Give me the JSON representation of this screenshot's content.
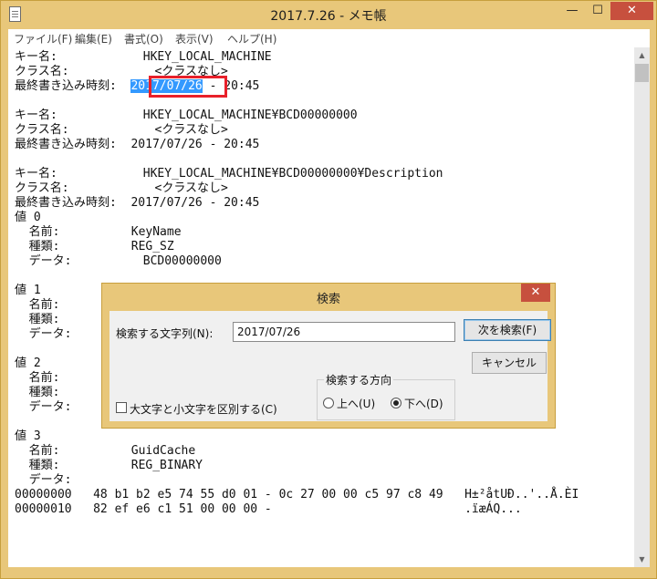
{
  "window": {
    "title": "2017.7.26 - メモ帳",
    "minimize_glyph": "—",
    "maximize_glyph": "☐",
    "close_glyph": "✕"
  },
  "menu": [
    "ファイル(F)",
    "編集(E)",
    "書式(O)",
    "表示(V)",
    "ヘルプ(H)"
  ],
  "editor": {
    "lines": [
      "キー名:            HKEY_LOCAL_MACHINE",
      "クラス名:            <クラスなし>",
      "最終書き込み時刻:  2017/07/26 - 20:45",
      "",
      "キー名:            HKEY_LOCAL_MACHINE¥BCD00000000",
      "クラス名:            <クラスなし>",
      "最終書き込み時刻:  2017/07/26 - 20:45",
      "",
      "キー名:            HKEY_LOCAL_MACHINE¥BCD00000000¥Description",
      "クラス名:            <クラスなし>",
      "最終書き込み時刻:  2017/07/26 - 20:45",
      "値 0",
      "  名前:          KeyName",
      "  種類:          REG_SZ",
      "  データ:          BCD00000000",
      "",
      "値 1",
      "  名前:",
      "  種類:",
      "  データ:",
      "",
      "値 2",
      "  名前:",
      "  種類:",
      "  データ:",
      "",
      "値 3",
      "  名前:          GuidCache",
      "  種類:          REG_BINARY",
      "  データ:",
      "00000000   48 b1 b2 e5 74 55 d0 01 - 0c 27 00 00 c5 97 c8 49   H±²åtUÐ..'..Å.ÈI",
      "00000010   82 ef e6 c1 51 00 00 00 -                           .ïæÁQ..."
    ],
    "line3_prefix": "最終書き込み時刻:  ",
    "line3_selected": "2017/07/26",
    "line3_suffix": " - 20:45"
  },
  "find_dialog": {
    "title": "検索",
    "close_glyph": "✕",
    "search_label": "検索する文字列(N):",
    "search_value": "2017/07/26",
    "find_next_label": "次を検索(F)",
    "cancel_label": "キャンセル",
    "direction_group_label": "検索する方向",
    "direction_up_label": "上へ(U)",
    "direction_down_label": "下へ(D)",
    "direction_selected": "down",
    "match_case_label": "大文字と小文字を区別する(C)",
    "match_case_checked": false
  },
  "scrollbar": {
    "up_glyph": "▲",
    "down_glyph": "▼"
  },
  "colors": {
    "frame": "#e8c77a",
    "selection": "#3399ff",
    "highlight_box": "#e8202a",
    "close_button": "#c7503e"
  }
}
